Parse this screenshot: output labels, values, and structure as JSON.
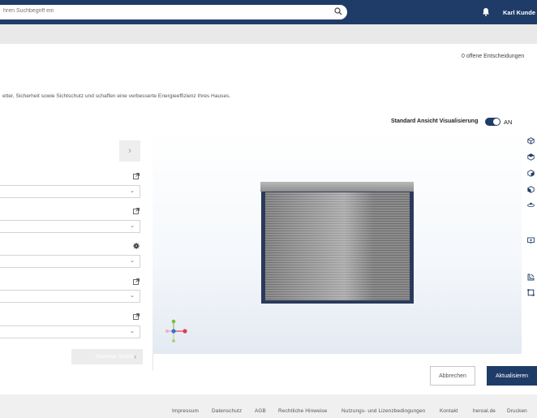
{
  "header": {
    "search_placeholder": "hren Suchbegriff ein",
    "user_name": "Karl Kunde",
    "user_chevron": "▾"
  },
  "status": {
    "open_decisions": "0 offene Entscheidungen"
  },
  "intro": {
    "text": "etter, Sicherheit sowie Sichtschutz und schaffen eine verbesserte Energieeffizienz Ihres Hauses."
  },
  "visualization": {
    "label": "Standard Ansicht Visualisierung",
    "toggle_state": "AN",
    "toggle_on": true
  },
  "config": {
    "nav_arrow": "›",
    "select_chevron": "⌄",
    "next_label": "Nächster Schritt",
    "next_arrow": "›",
    "option_icons": [
      "external-link-icon",
      "external-link-icon",
      "gear-icon",
      "external-link-icon",
      "external-link-icon"
    ]
  },
  "toolbar_icons": [
    "cube-outline-icon",
    "cube-top-icon",
    "cube-side-icon",
    "cube-front-icon",
    "orbit-icon",
    "screen-icon",
    "measure-icon",
    "frame-icon"
  ],
  "actions": {
    "cancel_label": "Abbrechen",
    "update_label": "Aktualisieren"
  },
  "footer": {
    "links": [
      "Impressum",
      "Datenschutz",
      "AGB",
      "Rechtliche Hinweise",
      "Nutzungs- und Lizenzbedingungen",
      "Kontakt",
      "heroal.de",
      "Drucken"
    ]
  },
  "colors": {
    "brand": "#1f3c68",
    "shutter_frame": "#2b3a5c",
    "shutter_slats": "#8d8d8d"
  }
}
